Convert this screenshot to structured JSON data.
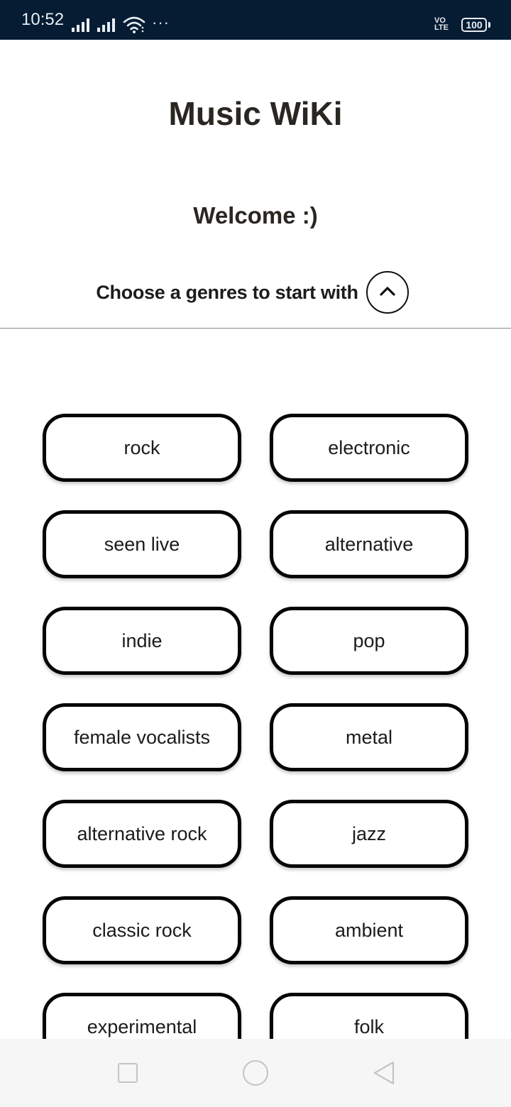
{
  "status_bar": {
    "time": "10:52",
    "overflow": "···",
    "volte_line1": "VO",
    "volte_line2": "LTE",
    "battery": "100",
    "icons": [
      "signal-icon",
      "signal-icon",
      "wifi-icon",
      "more-dots-icon",
      "volte-icon",
      "battery-icon"
    ]
  },
  "header": {
    "title": "Music WiKi",
    "welcome": "Welcome :)",
    "choose_prompt": "Choose a genres to start with",
    "toggle_icon": "chevron-up-icon"
  },
  "genres": [
    "rock",
    "electronic",
    "seen live",
    "alternative",
    "indie",
    "pop",
    "female vocalists",
    "metal",
    "alternative rock",
    "jazz",
    "classic rock",
    "ambient",
    "experimental",
    "folk"
  ],
  "nav_bar": {
    "icons": [
      "recents-icon",
      "home-icon",
      "back-icon"
    ]
  },
  "colors": {
    "status_bar_bg": "#051c33",
    "chip_border": "#050505",
    "text": "#222222",
    "nav_bar_bg": "#f6f6f6"
  }
}
